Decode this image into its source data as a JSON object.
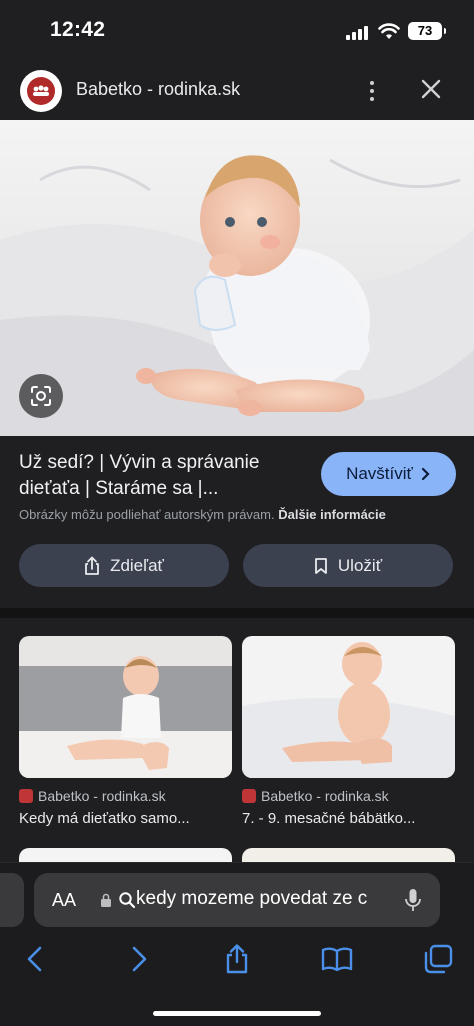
{
  "status_bar": {
    "time": "12:42",
    "battery": "73"
  },
  "header": {
    "site_name": "Babetko - rodinka.sk"
  },
  "result": {
    "title": "Už sedí? | Vývin a správanie dieťaťa | Staráme sa |...",
    "visit_label": "Navštíviť",
    "copyright_text": "Obrázky môžu podliehať autorským právam.",
    "more_info": "Ďalšie informácie",
    "share_label": "Zdieľať",
    "save_label": "Uložiť"
  },
  "related": [
    {
      "source": "Babetko - rodinka.sk",
      "caption": "Kedy má dieťatko samo..."
    },
    {
      "source": "Babetko - rodinka.sk",
      "caption": "7. - 9. mesačné bábätko..."
    }
  ],
  "address_bar": {
    "aa": "AA",
    "query": "kedy mozeme povedat ze c"
  },
  "icons": [
    "more-vert-icon",
    "close-icon",
    "lens-icon",
    "chevron-right-icon",
    "share-icon",
    "bookmark-icon",
    "lock-icon",
    "search-icon",
    "mic-icon",
    "back-icon",
    "forward-icon",
    "bookmarks-icon",
    "tabs-icon"
  ],
  "colors": {
    "accent": "#8ab4f8",
    "background": "#1f1f22",
    "button": "#3c4150"
  }
}
